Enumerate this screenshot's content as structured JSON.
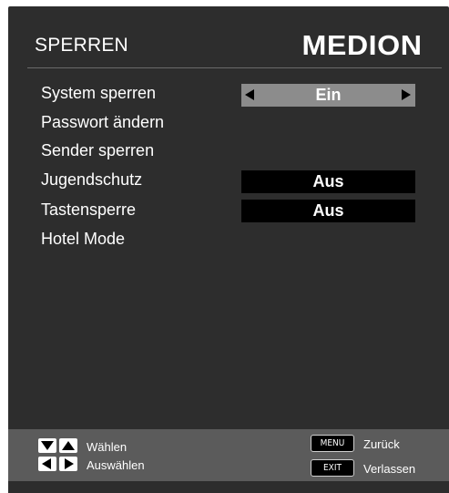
{
  "header": {
    "title": "SPERREN",
    "brand": "MEDION"
  },
  "menu": {
    "items": [
      {
        "label": "System sperren",
        "value": "Ein",
        "selected": true
      },
      {
        "label": "Passwort ändern"
      },
      {
        "label": "Sender sperren"
      },
      {
        "label": "Jugendschutz",
        "value": "Aus"
      },
      {
        "label": "Tastensperre",
        "value": "Aus"
      },
      {
        "label": "Hotel Mode"
      }
    ]
  },
  "footer": {
    "select_label": "Wählen",
    "choose_label": "Auswählen",
    "menu_key": "MENU",
    "back_label": "Zurück",
    "exit_key": "EXIT",
    "exit_label": "Verlassen"
  },
  "colors": {
    "panel": "#2d2d2d",
    "footer": "#5b5b5b",
    "selected_value": "#8c8c8c",
    "value_box": "#000000",
    "text": "#ffffff"
  },
  "icons": [
    "arrow-left-icon",
    "arrow-right-icon",
    "down-key-icon",
    "up-key-icon",
    "left-key-icon",
    "right-key-icon"
  ]
}
